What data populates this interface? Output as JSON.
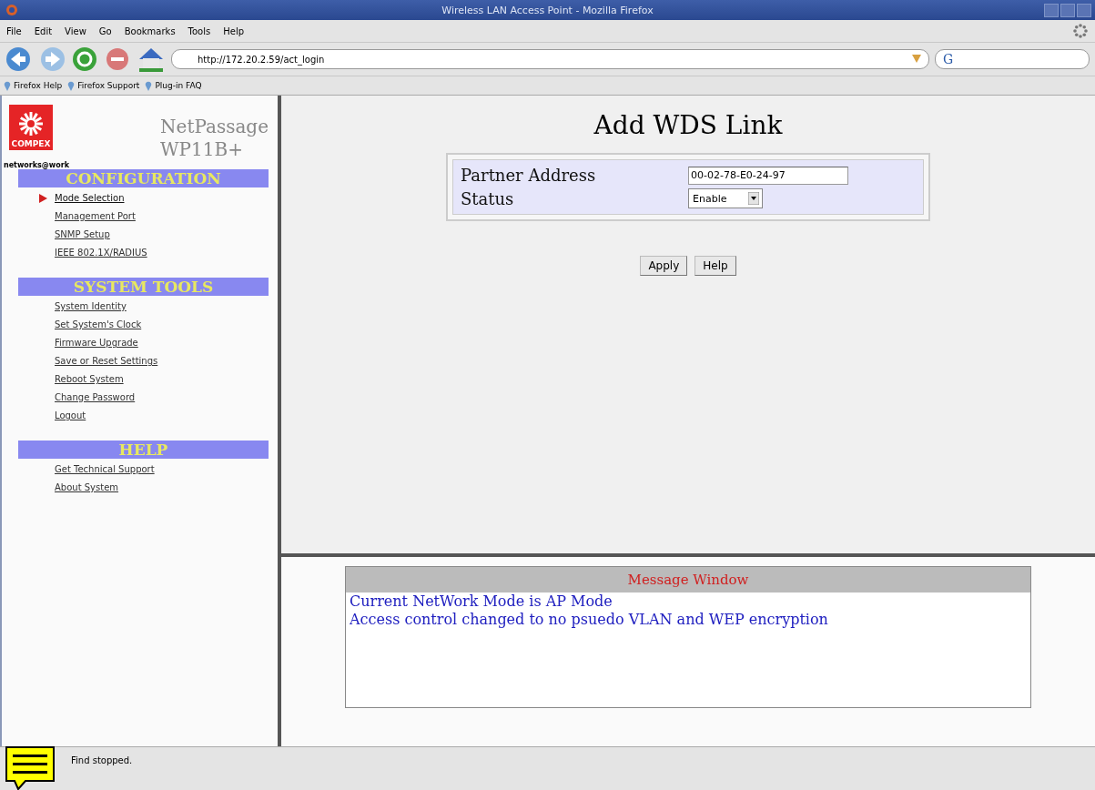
{
  "window": {
    "title": "Wireless LAN Access Point - Mozilla Firefox"
  },
  "menu": [
    "File",
    "Edit",
    "View",
    "Go",
    "Bookmarks",
    "Tools",
    "Help"
  ],
  "address": {
    "value": "http://172.20.2.59/act_login"
  },
  "search": {
    "engine_letter": "G"
  },
  "bookmarks": [
    "Firefox Help",
    "Firefox Support",
    "Plug-in FAQ"
  ],
  "brand": {
    "logo_text": "COMPEX",
    "product": "NetPassage",
    "model": "WP11B+",
    "tagline": "networks@work"
  },
  "sections": [
    {
      "title": "CONFIGURATION",
      "items": [
        {
          "label": "Mode Selection",
          "selected": true
        },
        {
          "label": "Management Port",
          "selected": false
        },
        {
          "label": "SNMP Setup",
          "selected": false
        },
        {
          "label": "IEEE 802.1X/RADIUS",
          "selected": false
        }
      ]
    },
    {
      "title": "SYSTEM TOOLS",
      "items": [
        {
          "label": "System Identity",
          "selected": false
        },
        {
          "label": "Set System's Clock",
          "selected": false
        },
        {
          "label": "Firmware Upgrade",
          "selected": false
        },
        {
          "label": "Save or Reset Settings",
          "selected": false
        },
        {
          "label": "Reboot System",
          "selected": false
        },
        {
          "label": "Change Password",
          "selected": false
        },
        {
          "label": "Logout",
          "selected": false
        }
      ]
    },
    {
      "title": "HELP",
      "items": [
        {
          "label": "Get Technical Support",
          "selected": false
        },
        {
          "label": "About System",
          "selected": false
        }
      ]
    }
  ],
  "form": {
    "title": "Add WDS Link",
    "fields": [
      {
        "kind": "text",
        "label": "Partner Address",
        "value": "00-02-78-E0-24-97"
      },
      {
        "kind": "select",
        "label": "Status",
        "value": "Enable"
      }
    ],
    "buttons": [
      "Apply",
      "Help"
    ]
  },
  "message_window": {
    "title": "Message Window",
    "lines": [
      "Current NetWork Mode is AP Mode",
      "Access control changed to no psuedo VLAN and WEP encryption"
    ]
  },
  "status_bar": {
    "text": "Find stopped."
  }
}
